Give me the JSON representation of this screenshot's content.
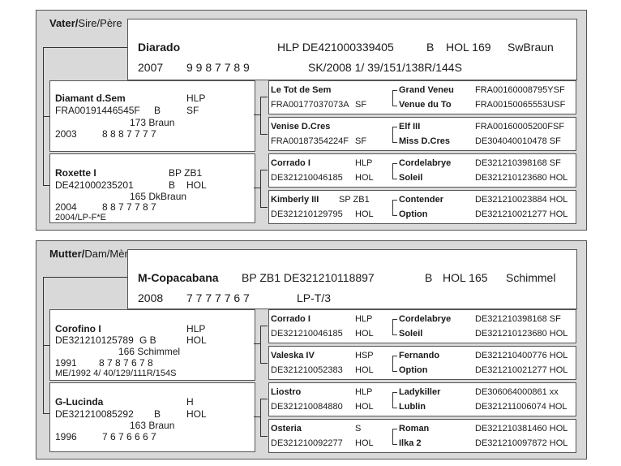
{
  "sire": {
    "section_label_bold": "Vater/",
    "section_label_rest": "Sire/Père",
    "name": "Diarado",
    "registration": "HLP  DE421000339405",
    "sex": "B",
    "breed_height": "HOL 169",
    "color": "SwBraun",
    "year": "2007",
    "score": "9 9 8 7 7 8 9",
    "test": "SK/2008  1/ 39/151/138R/144S",
    "father": {
      "name": "Diamant d.Sem",
      "reg_code": "HLP",
      "id": "FRA00191446545F",
      "sex": "B",
      "breed": "SF",
      "height_color": "173  Braun",
      "year": "2003",
      "score": "8 8 8 7 7 7 7",
      "extra": ""
    },
    "mother": {
      "name": "Roxette I",
      "reg_code": "BP ZB1",
      "id": "DE421000235201",
      "sex": "B",
      "breed": "HOL",
      "height_color": "165  DkBraun",
      "year": "2004",
      "score": "8 8 7 7 7 8 7",
      "extra": "2004/LP-F*E"
    },
    "gp": [
      {
        "name": "Le Tot de Sem",
        "code": "",
        "id": "FRA00177037073A",
        "breed": "SF",
        "gg1_name": "Grand Veneu",
        "gg1_id": "FRA00160008795YSF",
        "gg2_name": "Venue du To",
        "gg2_id": "FRA00150065553USF"
      },
      {
        "name": "Venise D.Cres",
        "code": "",
        "id": "FRA00187354224F",
        "breed": "SF",
        "gg1_name": "Elf III",
        "gg1_id": "FRA00160005200FSF",
        "gg2_name": "Miss D.Cres",
        "gg2_id": "DE304040010478  SF"
      },
      {
        "name": "Corrado I",
        "code": "HLP",
        "id": "DE321210046185",
        "breed": "HOL",
        "gg1_name": "Cordelabrye",
        "gg1_id": "DE321210398168  SF",
        "gg2_name": "Soleil",
        "gg2_id": "DE321210123680  HOL"
      },
      {
        "name": "Kimberly III",
        "code": "SP ZB1",
        "id": "DE321210129795",
        "breed": "HOL",
        "gg1_name": "Contender",
        "gg1_id": "DE321210023884  HOL",
        "gg2_name": "Option",
        "gg2_id": "DE321210021277  HOL"
      }
    ]
  },
  "dam": {
    "section_label_bold": "Mutter/",
    "section_label_rest": "Dam/Mère",
    "name": "M-Copacabana",
    "registration": "BP ZB1    DE321210118897",
    "sex": "B",
    "breed_height": "HOL 165",
    "color": "Schimmel",
    "year": "2008",
    "score": "7 7 7 7 7 6 7",
    "test": "LP-T/3",
    "father": {
      "name": "Corofino I",
      "reg_code": "HLP",
      "id": "DE321210125789",
      "sex": "G B",
      "breed": "HOL",
      "height_color": "166  Schimmel",
      "year": "1991",
      "score": "8 7 8 7 6 7 8",
      "extra": "ME/1992  4/ 40/129/111R/154S"
    },
    "mother": {
      "name": "G-Lucinda",
      "reg_code": "H",
      "id": "DE321210085292",
      "sex": "B",
      "breed": "HOL",
      "height_color": "163  Braun",
      "year": "1996",
      "score": "7 6 7 6 6 6 7",
      "extra": ""
    },
    "gp": [
      {
        "name": "Corrado I",
        "code": "HLP",
        "id": "DE321210046185",
        "breed": "HOL",
        "gg1_name": "Cordelabrye",
        "gg1_id": "DE321210398168  SF",
        "gg2_name": "Soleil",
        "gg2_id": "DE321210123680  HOL"
      },
      {
        "name": "Valeska IV",
        "code": "HSP",
        "id": "DE321210052383",
        "breed": "HOL",
        "gg1_name": "Fernando",
        "gg1_id": "DE321210400776  HOL",
        "gg2_name": "Option",
        "gg2_id": "DE321210021277  HOL"
      },
      {
        "name": "Liostro",
        "code": "HLP",
        "id": "DE321210084880",
        "breed": "HOL",
        "gg1_name": "Ladykiller",
        "gg1_id": "DE306064000861  xx",
        "gg2_name": "Lublin",
        "gg2_id": "DE321211006074  HOL"
      },
      {
        "name": "Osteria",
        "code": "S",
        "id": "DE321210092277",
        "breed": "HOL",
        "gg1_name": "Roman",
        "gg1_id": "DE321210381460  HOL",
        "gg2_name": "Ilka 2",
        "gg2_id": "DE321210097872  HOL"
      }
    ]
  }
}
